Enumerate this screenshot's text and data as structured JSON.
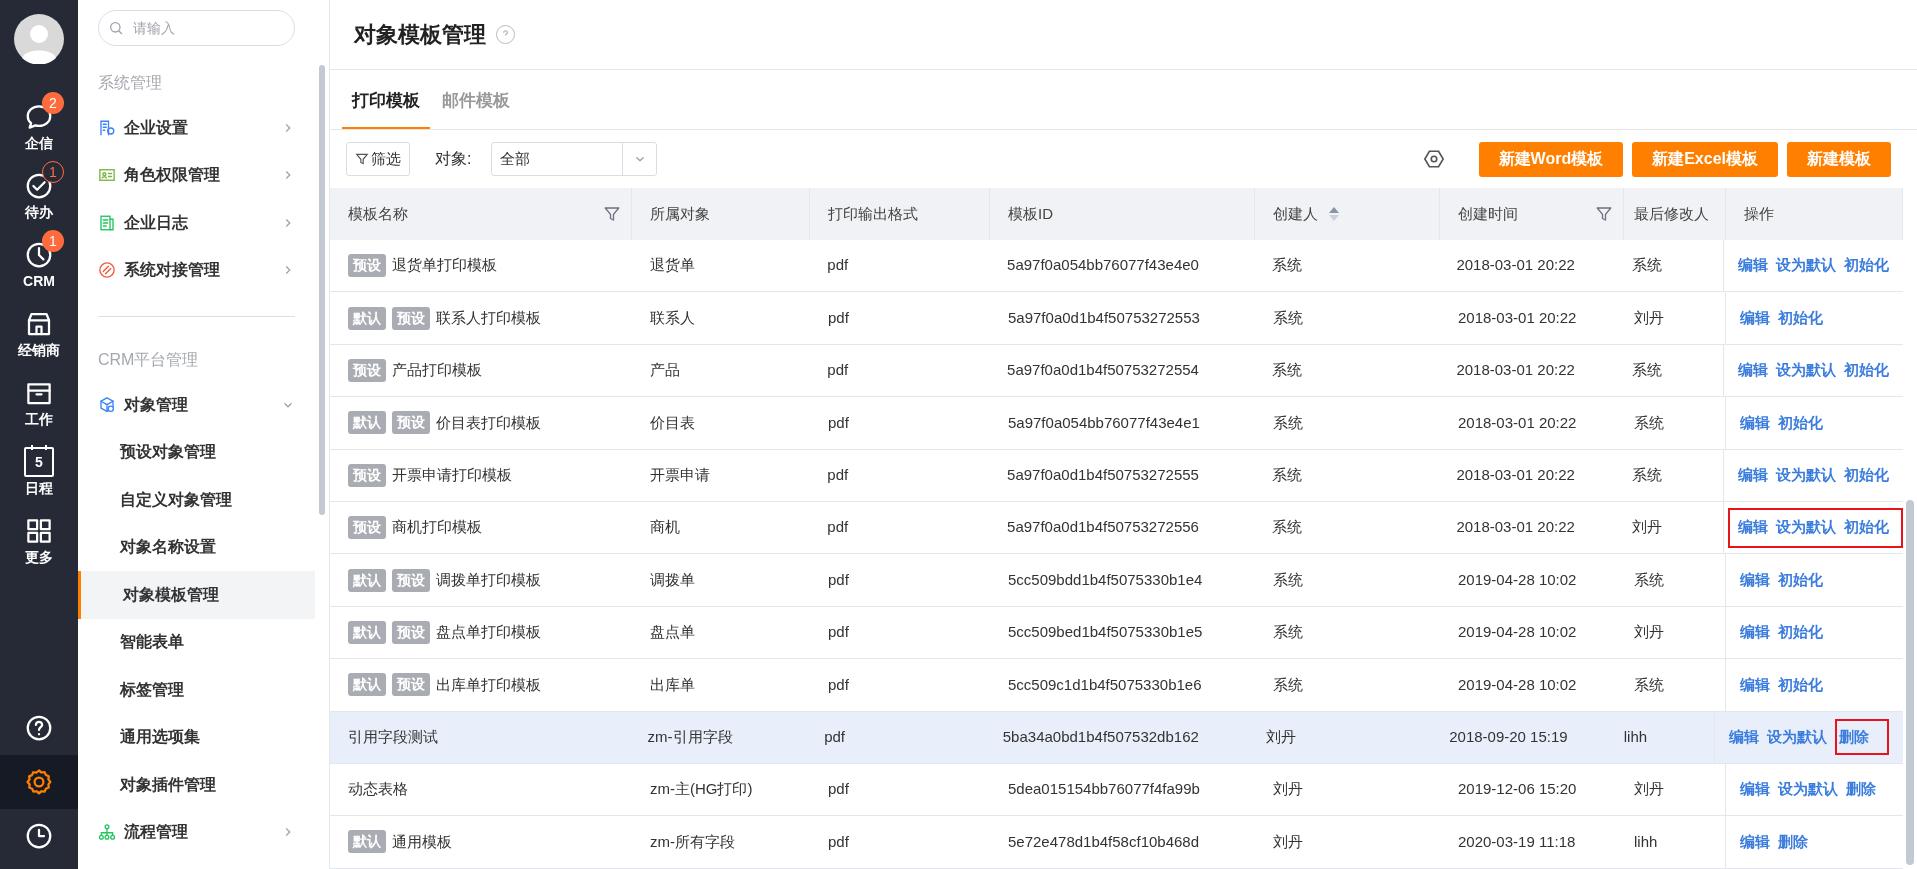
{
  "nav": {
    "items": [
      {
        "label": "企信",
        "badge": "2"
      },
      {
        "label": "待办",
        "badge": "1"
      },
      {
        "label": "CRM",
        "badge": "1"
      },
      {
        "label": "经销商"
      },
      {
        "label": "工作"
      },
      {
        "label": "日程",
        "icon_text": "5"
      },
      {
        "label": "更多"
      }
    ],
    "bottom": [
      {
        "selected": false
      },
      {
        "selected": true
      },
      {
        "selected": false
      }
    ]
  },
  "sidebar": {
    "search_placeholder": "请输入",
    "sections": [
      {
        "title": "系统管理",
        "items": [
          {
            "label": "企业设置",
            "expanded": false
          },
          {
            "label": "角色权限管理",
            "expanded": false
          },
          {
            "label": "企业日志",
            "expanded": false
          },
          {
            "label": "系统对接管理",
            "expanded": false
          }
        ]
      },
      {
        "title": "CRM平台管理",
        "items": [
          {
            "label": "对象管理",
            "expanded": true,
            "children": [
              {
                "label": "预设对象管理",
                "selected": false
              },
              {
                "label": "自定义对象管理",
                "selected": false
              },
              {
                "label": "对象名称设置",
                "selected": false
              },
              {
                "label": "对象模板管理",
                "selected": true
              },
              {
                "label": "智能表单",
                "selected": false
              },
              {
                "label": "标签管理",
                "selected": false
              },
              {
                "label": "通用选项集",
                "selected": false
              },
              {
                "label": "对象插件管理",
                "selected": false
              }
            ]
          },
          {
            "label": "流程管理",
            "expanded": false
          }
        ]
      }
    ]
  },
  "page": {
    "title": "对象模板管理"
  },
  "tabs": [
    {
      "label": "打印模板",
      "selected": true
    },
    {
      "label": "邮件模板",
      "selected": false
    }
  ],
  "toolbar": {
    "filter_button": "筛选",
    "object_label": "对象:",
    "object_value": "全部",
    "buttons": [
      "新建Word模板",
      "新建Excel模板",
      "新建模板"
    ]
  },
  "table": {
    "columns": [
      {
        "label": "模板名称",
        "filter": true,
        "sort": false
      },
      {
        "label": "所属对象",
        "filter": false,
        "sort": false
      },
      {
        "label": "打印输出格式",
        "filter": false,
        "sort": false
      },
      {
        "label": "模板ID",
        "filter": false,
        "sort": false
      },
      {
        "label": "创建人",
        "filter": false,
        "sort": true
      },
      {
        "label": "创建时间",
        "filter": true,
        "sort": false
      },
      {
        "label": "最后修改人",
        "filter": false,
        "sort": false
      },
      {
        "label": "操作",
        "filter": false,
        "sort": false
      }
    ],
    "rows": [
      {
        "tags": [
          "预设"
        ],
        "name": "退货单打印模板",
        "object": "退货单",
        "format": "pdf",
        "id": "5a97f0a054bb76077f43e4e0",
        "creator": "系统",
        "created": "2018-03-01 20:22",
        "modifier": "系统",
        "hovered": false,
        "actions_highlighted": false,
        "actions": [
          {
            "label": "编辑",
            "highlighted": false
          },
          {
            "label": "设为默认",
            "highlighted": false
          },
          {
            "label": "初始化",
            "highlighted": false
          }
        ]
      },
      {
        "tags": [
          "默认",
          "预设"
        ],
        "name": "联系人打印模板",
        "object": "联系人",
        "format": "pdf",
        "id": "5a97f0a0d1b4f50753272553",
        "creator": "系统",
        "created": "2018-03-01 20:22",
        "modifier": "刘丹",
        "hovered": false,
        "actions_highlighted": false,
        "actions": [
          {
            "label": "编辑",
            "highlighted": false
          },
          {
            "label": "初始化",
            "highlighted": false
          }
        ]
      },
      {
        "tags": [
          "预设"
        ],
        "name": "产品打印模板",
        "object": "产品",
        "format": "pdf",
        "id": "5a97f0a0d1b4f50753272554",
        "creator": "系统",
        "created": "2018-03-01 20:22",
        "modifier": "系统",
        "hovered": false,
        "actions_highlighted": false,
        "actions": [
          {
            "label": "编辑",
            "highlighted": false
          },
          {
            "label": "设为默认",
            "highlighted": false
          },
          {
            "label": "初始化",
            "highlighted": false
          }
        ]
      },
      {
        "tags": [
          "默认",
          "预设"
        ],
        "name": "价目表打印模板",
        "object": "价目表",
        "format": "pdf",
        "id": "5a97f0a054bb76077f43e4e1",
        "creator": "系统",
        "created": "2018-03-01 20:22",
        "modifier": "系统",
        "hovered": false,
        "actions_highlighted": false,
        "actions": [
          {
            "label": "编辑",
            "highlighted": false
          },
          {
            "label": "初始化",
            "highlighted": false
          }
        ]
      },
      {
        "tags": [
          "预设"
        ],
        "name": "开票申请打印模板",
        "object": "开票申请",
        "format": "pdf",
        "id": "5a97f0a0d1b4f50753272555",
        "creator": "系统",
        "created": "2018-03-01 20:22",
        "modifier": "系统",
        "hovered": false,
        "actions_highlighted": false,
        "actions": [
          {
            "label": "编辑",
            "highlighted": false
          },
          {
            "label": "设为默认",
            "highlighted": false
          },
          {
            "label": "初始化",
            "highlighted": false
          }
        ]
      },
      {
        "tags": [
          "预设"
        ],
        "name": "商机打印模板",
        "object": "商机",
        "format": "pdf",
        "id": "5a97f0a0d1b4f50753272556",
        "creator": "系统",
        "created": "2018-03-01 20:22",
        "modifier": "刘丹",
        "hovered": false,
        "actions_highlighted": true,
        "actions": [
          {
            "label": "编辑",
            "highlighted": false
          },
          {
            "label": "设为默认",
            "highlighted": false
          },
          {
            "label": "初始化",
            "highlighted": false
          }
        ]
      },
      {
        "tags": [
          "默认",
          "预设"
        ],
        "name": "调拨单打印模板",
        "object": "调拨单",
        "format": "pdf",
        "id": "5cc509bdd1b4f5075330b1e4",
        "creator": "系统",
        "created": "2019-04-28 10:02",
        "modifier": "系统",
        "hovered": false,
        "actions_highlighted": false,
        "actions": [
          {
            "label": "编辑",
            "highlighted": false
          },
          {
            "label": "初始化",
            "highlighted": false
          }
        ]
      },
      {
        "tags": [
          "默认",
          "预设"
        ],
        "name": "盘点单打印模板",
        "object": "盘点单",
        "format": "pdf",
        "id": "5cc509bed1b4f5075330b1e5",
        "creator": "系统",
        "created": "2019-04-28 10:02",
        "modifier": "刘丹",
        "hovered": false,
        "actions_highlighted": false,
        "actions": [
          {
            "label": "编辑",
            "highlighted": false
          },
          {
            "label": "初始化",
            "highlighted": false
          }
        ]
      },
      {
        "tags": [
          "默认",
          "预设"
        ],
        "name": "出库单打印模板",
        "object": "出库单",
        "format": "pdf",
        "id": "5cc509c1d1b4f5075330b1e6",
        "creator": "系统",
        "created": "2019-04-28 10:02",
        "modifier": "系统",
        "hovered": false,
        "actions_highlighted": false,
        "actions": [
          {
            "label": "编辑",
            "highlighted": false
          },
          {
            "label": "初始化",
            "highlighted": false
          }
        ]
      },
      {
        "name": "引用字段测试",
        "object": "zm-引用字段",
        "format": "pdf",
        "id": "5ba34a0bd1b4f507532db162",
        "creator": "刘丹",
        "created": "2018-09-20 15:19",
        "modifier": "lihh",
        "hovered": true,
        "actions_highlighted": false,
        "actions": [
          {
            "label": "编辑",
            "highlighted": false
          },
          {
            "label": "设为默认",
            "highlighted": false
          },
          {
            "label": "删除",
            "highlighted": true
          }
        ]
      },
      {
        "name": "动态表格",
        "object": "zm-主(HG打印)",
        "format": "pdf",
        "id": "5dea015154bb76077f4fa99b",
        "creator": "刘丹",
        "created": "2019-12-06 15:20",
        "modifier": "刘丹",
        "hovered": false,
        "actions_highlighted": false,
        "actions": [
          {
            "label": "编辑",
            "highlighted": false
          },
          {
            "label": "设为默认",
            "highlighted": false
          },
          {
            "label": "删除",
            "highlighted": false
          }
        ]
      },
      {
        "tags": [
          "默认"
        ],
        "name": "通用模板",
        "object": "zm-所有字段",
        "format": "pdf",
        "id": "5e72e478d1b4f58cf10b468d",
        "creator": "刘丹",
        "created": "2020-03-19 11:18",
        "modifier": "lihh",
        "hovered": false,
        "actions_highlighted": false,
        "actions": [
          {
            "label": "编辑",
            "highlighted": false
          },
          {
            "label": "删除",
            "highlighted": false
          }
        ]
      }
    ]
  }
}
